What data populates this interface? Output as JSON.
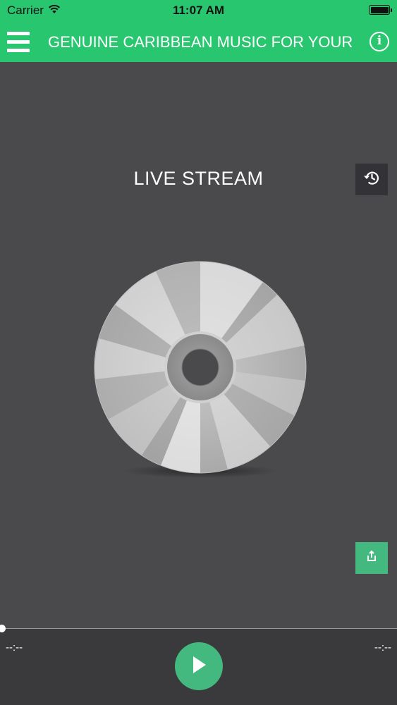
{
  "status_bar": {
    "carrier": "Carrier",
    "time": "11:07 AM",
    "icons": [
      "wifi-icon",
      "battery-icon"
    ]
  },
  "nav": {
    "title": "GENUINE CARIBBEAN MUSIC FOR YOUR",
    "menu_icon": "hamburger-menu-icon",
    "info_icon": "info-icon"
  },
  "main": {
    "stream_title": "LIVE STREAM",
    "history_icon": "history-icon",
    "share_icon": "share-icon",
    "artwork_icon": "compact-disc-icon"
  },
  "player": {
    "elapsed": "--:--",
    "remaining": "--:--",
    "progress": 0,
    "play_icon": "play-icon"
  },
  "colors": {
    "accent": "#28c76f",
    "button_green": "#43b97f",
    "background": "#4a494c",
    "player_bar": "#3a393c"
  }
}
